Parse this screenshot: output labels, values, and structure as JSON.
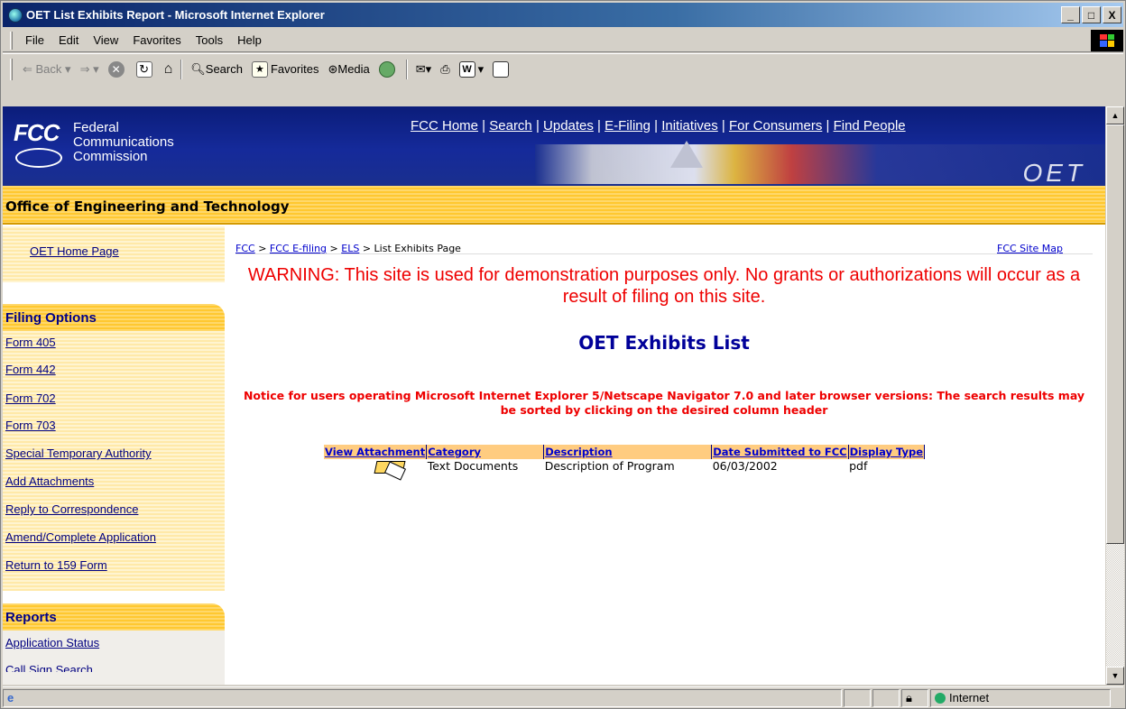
{
  "window": {
    "title": "OET List Exhibits Report - Microsoft Internet Explorer",
    "min": "_",
    "max": "□",
    "close": "X"
  },
  "menu": [
    "File",
    "Edit",
    "View",
    "Favorites",
    "Tools",
    "Help"
  ],
  "toolbar": {
    "back": "Back",
    "search": "Search",
    "favorites": "Favorites",
    "media": "Media"
  },
  "header": {
    "logo": "FCC",
    "agency_lines": [
      "Federal",
      "Communications",
      "Commission"
    ],
    "links": [
      "FCC Home",
      "Search",
      "Updates",
      "E-Filing",
      "Initiatives",
      "For Consumers",
      "Find People"
    ],
    "section_logo": "OET",
    "banner": "Office of Engineering and Technology"
  },
  "sidebar": {
    "home_link": "OET Home Page",
    "filing_heading": "Filing Options",
    "filing_items": [
      "Form 405",
      "Form 442",
      "Form 702",
      "Form 703",
      "Special Temporary Authority",
      "Add Attachments",
      "Reply to Correspondence",
      "Amend/Complete Application",
      "Return to 159 Form"
    ],
    "reports_heading": "Reports",
    "reports_items": [
      "Application Status",
      "Call Sign Search"
    ]
  },
  "breadcrumb": {
    "items": [
      "FCC",
      "FCC E-filing",
      "ELS"
    ],
    "sep": ">",
    "current": "List Exhibits Page",
    "site_map": "FCC Site Map"
  },
  "warning": "WARNING: This site is used for demonstration purposes only. No grants or authorizations will occur as a result of filing on this site.",
  "page_title": "OET Exhibits List",
  "notice": "Notice for users operating Microsoft Internet Explorer 5/Netscape Navigator 7.0 and later browser versions: The search results may be sorted by clicking on the desired column header",
  "table": {
    "headers": [
      "View Attachment",
      "Category",
      "Description",
      "Date Submitted to FCC",
      "Display Type"
    ],
    "rows": [
      {
        "category": "Text Documents",
        "description": "Description of Program",
        "date": "06/03/2002",
        "display_type": "pdf"
      }
    ]
  },
  "status": {
    "zone": "Internet"
  },
  "colors": {
    "fcc_blue": "#152a9a",
    "accent_orange": "#ffc830",
    "warning_red": "#e00000",
    "title_blue": "#000099"
  },
  "icons": [
    "ie-logo-icon",
    "windows-logo-icon",
    "back-icon",
    "forward-icon",
    "stop-icon",
    "refresh-icon",
    "home-icon",
    "search-icon",
    "favorites-icon",
    "media-icon",
    "history-icon",
    "mail-icon",
    "print-icon",
    "edit-icon",
    "discuss-icon",
    "attachment-icon",
    "lock-icon",
    "globe-icon"
  ]
}
